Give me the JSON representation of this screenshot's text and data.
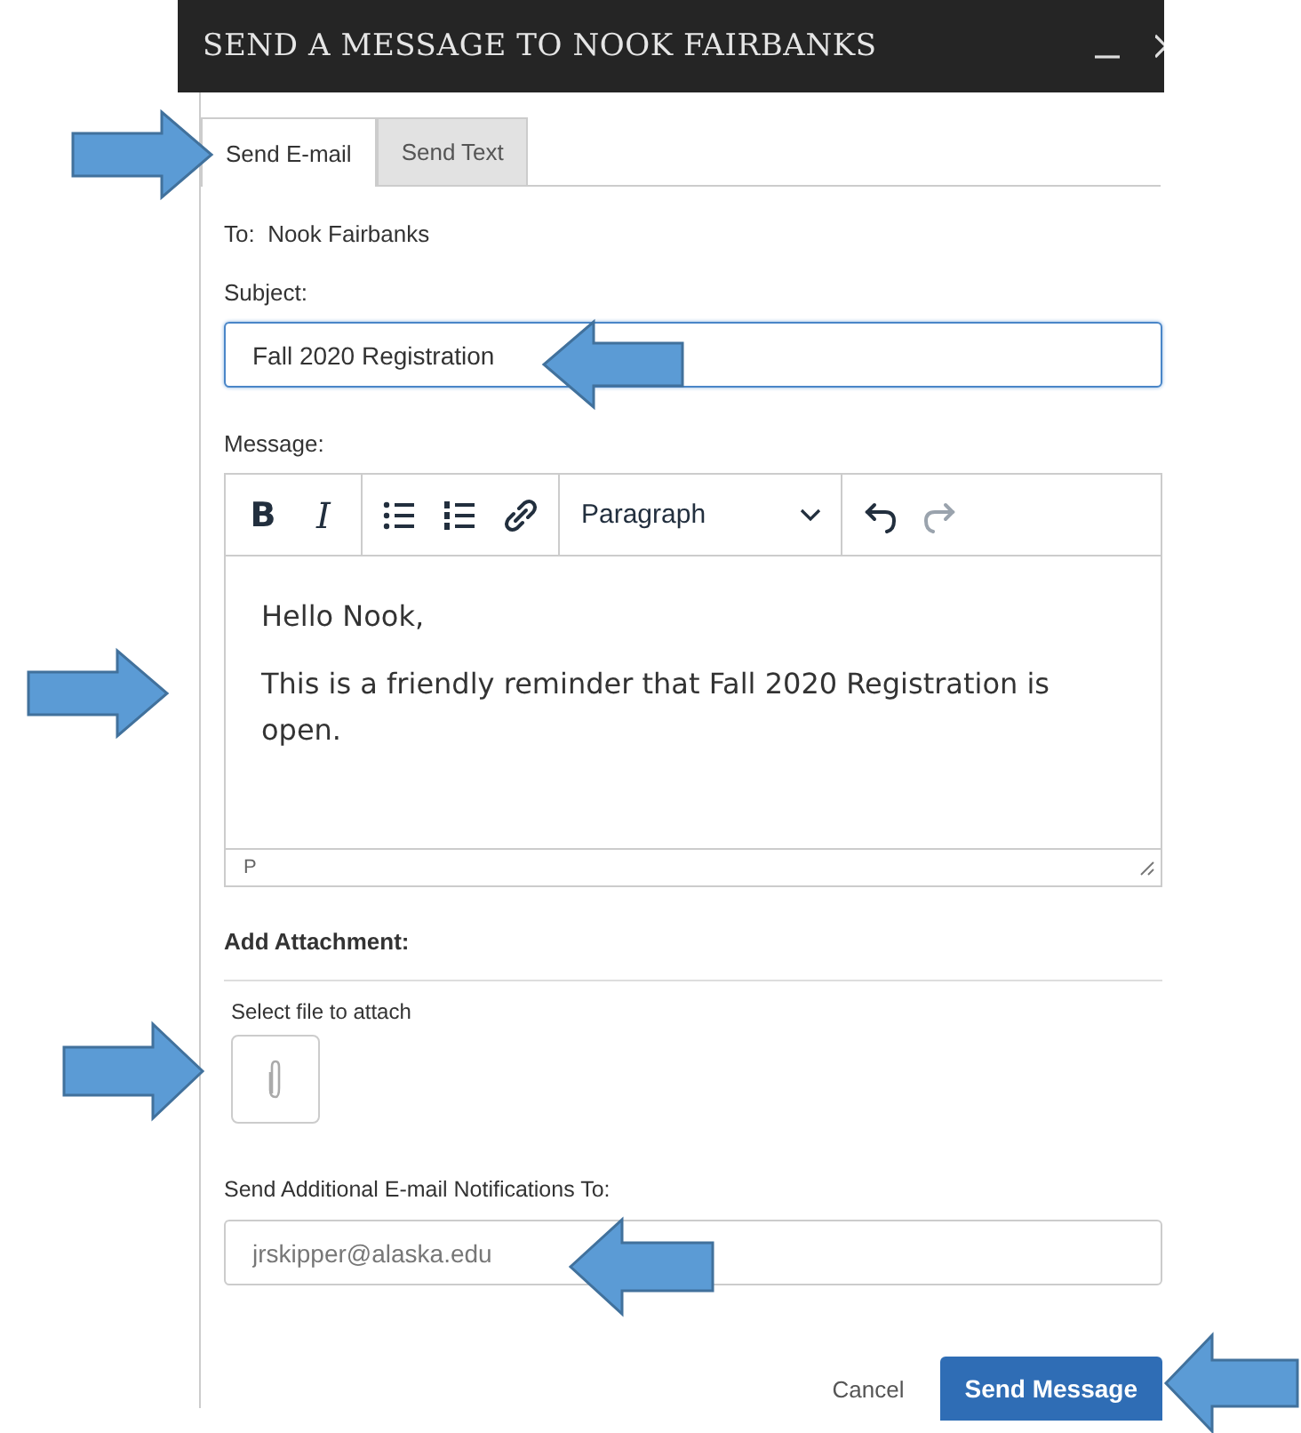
{
  "window": {
    "title": "SEND A MESSAGE TO NOOK FAIRBANKS"
  },
  "tabs": [
    {
      "label": "Send E-mail",
      "selected": true
    },
    {
      "label": "Send Text",
      "selected": false
    }
  ],
  "to": {
    "label": "To:",
    "value": "Nook Fairbanks"
  },
  "subject": {
    "label": "Subject:",
    "value": "Fall 2020 Registration",
    "focused": true
  },
  "message": {
    "label": "Message:",
    "toolbar": [
      [
        {
          "kind": "bold",
          "glyph": "B",
          "disabled": false
        },
        {
          "kind": "italic",
          "glyph": "I",
          "disabled": false
        }
      ],
      [
        {
          "kind": "bullet-list",
          "disabled": false
        },
        {
          "kind": "numbered-list",
          "disabled": false
        },
        {
          "kind": "link",
          "disabled": false
        }
      ],
      [
        {
          "kind": "select",
          "value": "Paragraph"
        }
      ],
      [
        {
          "kind": "undo",
          "disabled": false
        },
        {
          "kind": "redo",
          "disabled": true
        }
      ]
    ],
    "paragraphs": [
      "Hello Nook,",
      "This is a friendly reminder that Fall 2020 Registration is open."
    ],
    "status_path": "P"
  },
  "attachment": {
    "heading": "Add Attachment:",
    "prompt": "Select file to attach"
  },
  "notifications": {
    "label": "Send Additional E-mail Notifications To:",
    "placeholder": "jrskipper@alaska.edu"
  },
  "buttons": [
    {
      "label": "Cancel",
      "kind": "link"
    },
    {
      "label": "Send Message",
      "kind": "primary"
    }
  ]
}
